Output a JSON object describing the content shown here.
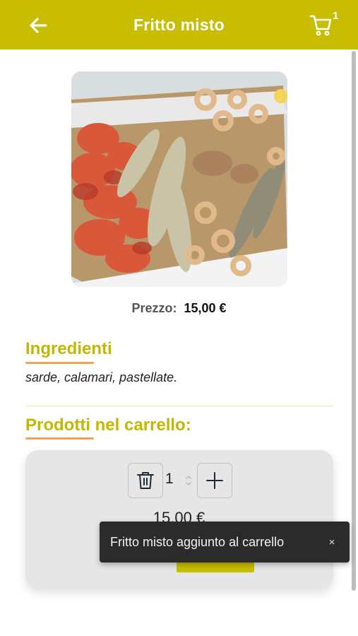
{
  "header": {
    "title": "Fritto misto",
    "cart_count": "1",
    "icons": {
      "back": "arrow-left-icon",
      "cart": "cart-icon"
    }
  },
  "product": {
    "image_description": "fried seafood platter",
    "price_label": "Prezzo:",
    "price_value": "15,00 €"
  },
  "ingredients": {
    "title": "Ingredienti",
    "text": "sarde, calamari, pastellate."
  },
  "cart_section": {
    "title": "Prodotti nel carrello:",
    "quantity": "1",
    "item_price": "15,00 €",
    "icons": {
      "delete": "trash-icon",
      "increment": "plus-icon"
    }
  },
  "toast": {
    "message": "Fritto misto aggiunto al carrello",
    "close_label": "×"
  },
  "colors": {
    "brand": "#c8bd00",
    "section_title": "#c3b700",
    "underline": "#f0a35c",
    "toast_bg": "#2b2b2b"
  }
}
